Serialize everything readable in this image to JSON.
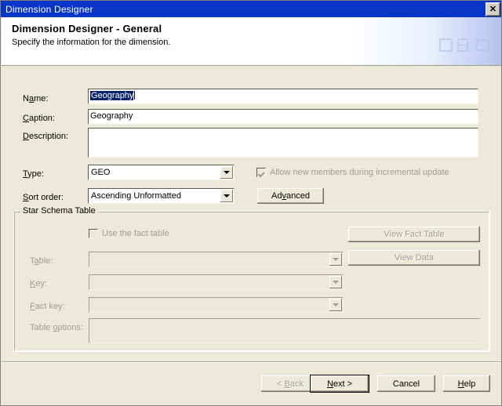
{
  "window": {
    "title": "Dimension Designer",
    "close_label": "✕"
  },
  "header": {
    "title": "Dimension Designer - General",
    "subtitle": "Specify the information for the dimension."
  },
  "form": {
    "name": {
      "label": "Name:",
      "accel": "a",
      "value": "Geography",
      "selected": true
    },
    "caption": {
      "label": "Caption:",
      "accel": "C",
      "value": "Geography"
    },
    "description": {
      "label": "Description:",
      "accel": "D",
      "value": ""
    },
    "type": {
      "label": "Type:",
      "accel": "T",
      "value": "GEO"
    },
    "sort_order": {
      "label": "Sort order:",
      "accel": "S",
      "value": "Ascending Unformatted"
    },
    "allow_new_members": {
      "label": "Allow new members during incremental update",
      "checked": true,
      "enabled": false
    },
    "advanced_button": {
      "label": "Advanced",
      "enabled": true
    }
  },
  "star_schema": {
    "legend": "Star Schema Table",
    "use_fact_table": {
      "label": "Use the fact table",
      "checked": false,
      "enabled": false
    },
    "view_fact_table_button": {
      "label": "View Fact Table",
      "enabled": false
    },
    "view_data_button": {
      "label": "View Data",
      "enabled": false
    },
    "table": {
      "label": "Table:",
      "value": "",
      "enabled": false
    },
    "key": {
      "label": "Key:",
      "value": "",
      "enabled": false
    },
    "fact_key": {
      "label": "Fact key:",
      "value": "",
      "enabled": false
    },
    "table_options": {
      "label": "Table options:",
      "value": "",
      "enabled": false
    }
  },
  "footer": {
    "back": {
      "label": "< Back",
      "enabled": false
    },
    "next": {
      "label": "Next >",
      "enabled": true,
      "is_default": true
    },
    "cancel": {
      "label": "Cancel",
      "enabled": true
    },
    "help": {
      "label": "Help",
      "enabled": true
    }
  },
  "colors": {
    "titlebar": "#0A36C8",
    "dialog_face": "#ECE9D8",
    "selection": "#0A246A",
    "disabled_text": "#9D9D8E"
  }
}
